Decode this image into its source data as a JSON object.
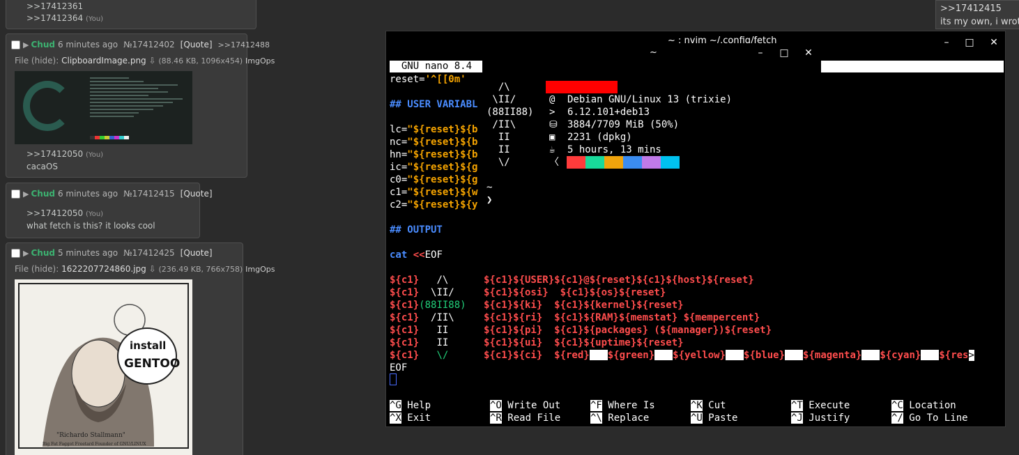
{
  "thread": {
    "post0": {
      "ql1": ">>17412361",
      "ql2": ">>17412364",
      "you": "(You)"
    },
    "post1": {
      "name": "Chud",
      "time": "6 minutes ago",
      "no": "№17412402",
      "quote": "[Quote]",
      "backlink": ">>17412488",
      "file_label": "File",
      "hide": "(hide)",
      "colon": ":",
      "filename": "ClipboardImage.png",
      "download": "⇩",
      "size": "(88.46 KB, 1096x454)",
      "imgops": "ImgOps",
      "ql": ">>17412050",
      "you": "(You)",
      "text": "cacaOS"
    },
    "post2": {
      "name": "Chud",
      "time": "6 minutes ago",
      "no": "№17412415",
      "quote": "[Quote]",
      "ql": ">>17412050",
      "you": "(You)",
      "text": "what fetch is this? it looks cool"
    },
    "post3": {
      "name": "Chud",
      "time": "5 minutes ago",
      "no": "№17412425",
      "quote": "[Quote]",
      "file_label": "File",
      "hide": "(hide)",
      "colon": ":",
      "filename": "1622207724860.jpg",
      "download": "⇩",
      "size": "(236.49 KB, 766x758)",
      "imgops": "ImgOps",
      "img_text1": "install",
      "img_text2": "GENTOO",
      "img_caption": "\"Richardo Stallmann\"",
      "img_sub": "Big Fat Faggot Freetard Founder of GNU/LINUX"
    },
    "right_post": {
      "ql": ">>17412415",
      "text": "its my own, i wrote"
    }
  },
  "terminal_back": {
    "title": "~ : nvim ~/.config/fetch",
    "nano_title": "  GNU nano 8.4",
    "lines": {
      "reset": [
        "reset=",
        "'^[[0m'"
      ],
      "uservar": "## USER VARIABL",
      "lc": [
        "lc=",
        "\"${reset}${b"
      ],
      "nc": [
        "nc=",
        "\"${reset}${b"
      ],
      "hn": [
        "hn=",
        "\"${reset}${b"
      ],
      "ic": [
        "ic=",
        "\"${reset}${g"
      ],
      "c0": [
        "c0=",
        "\"${reset}${g"
      ],
      "c1": [
        "c1=",
        "\"${reset}${w"
      ],
      "c2": [
        "c2=",
        "\"${reset}${y"
      ],
      "output": "## OUTPUT",
      "cat": "cat",
      "heredoc": "<<",
      "eof_tag": "EOF",
      "eof": "EOF"
    },
    "art": {
      "r1": {
        "pre": "${c1}",
        "art": "   /\\",
        "info": "${c1}${USER}${c1}@${reset}${c1}${host}${reset}"
      },
      "r2": {
        "pre": "${c1}",
        "art": "  \\II/",
        "info": "${c1}${osi}  ${c1}${os}${reset}"
      },
      "r3": {
        "pre": "${c1}",
        "art": "(88II88)",
        "info": "${c1}${ki}  ${c1}${kernel}${reset}"
      },
      "r4": {
        "pre": "${c1}",
        "art": "  /II\\",
        "info": "${c1}${ri}  ${c1}${RAM}${memstat} ${mempercent}"
      },
      "r5": {
        "pre": "${c1}",
        "art": "   II",
        "info": "${c1}${pi}  ${c1}${packages} (${manager})${reset}"
      },
      "r6": {
        "pre": "${c1}",
        "art": "   II",
        "info": "${c1}${ui}  ${c1}${uptime}${reset}"
      },
      "r7": {
        "pre": "${c1}",
        "art": "   \\/",
        "info": "${c1}${ci}  ${red}",
        "colors": [
          "${green}",
          "${yellow}",
          "${blue}",
          "${magenta}",
          "${cyan}",
          "${res"
        ],
        "more": ">"
      }
    },
    "shortcuts": [
      {
        "k1": "^G",
        "l1": "Help",
        "k2": "^X",
        "l2": "Exit"
      },
      {
        "k1": "^O",
        "l1": "Write Out",
        "k2": "^R",
        "l2": "Read File"
      },
      {
        "k1": "^F",
        "l1": "Where Is",
        "k2": "^\\",
        "l2": "Replace"
      },
      {
        "k1": "^K",
        "l1": "Cut",
        "k2": "^U",
        "l2": "Paste"
      },
      {
        "k1": "^T",
        "l1": "Execute",
        "k2": "^J",
        "l2": "Justify"
      },
      {
        "k1": "^C",
        "l1": "Location",
        "k2": "^/",
        "l2": "Go To Line"
      }
    ],
    "btn_min": "–",
    "btn_max": "□",
    "btn_close": "✕"
  },
  "terminal_front": {
    "title": "~",
    "btn_min": "–",
    "btn_max": "□",
    "btn_close": "✕",
    "art": [
      "  /\\",
      " \\II/",
      "(88II88)",
      " /II\\",
      "  II",
      "  II",
      "  \\/"
    ],
    "icons": [
      "@",
      ">",
      "⛁",
      "▣",
      "☕",
      "〈"
    ],
    "info": {
      "os": "Debian GNU/Linux 13 (trixie)",
      "kernel": "6.12.101+deb13",
      "ram": "3884/7709 MiB (50%)",
      "packages": "2231 (dpkg)",
      "uptime": "5 hours, 13 mins"
    },
    "palette": [
      "#ff3b3b",
      "#18d99a",
      "#f0a40c",
      "#3b8cf0",
      "#c07ae8",
      "#00c2f0"
    ],
    "prompt1": "~",
    "prompt2": "❯"
  }
}
